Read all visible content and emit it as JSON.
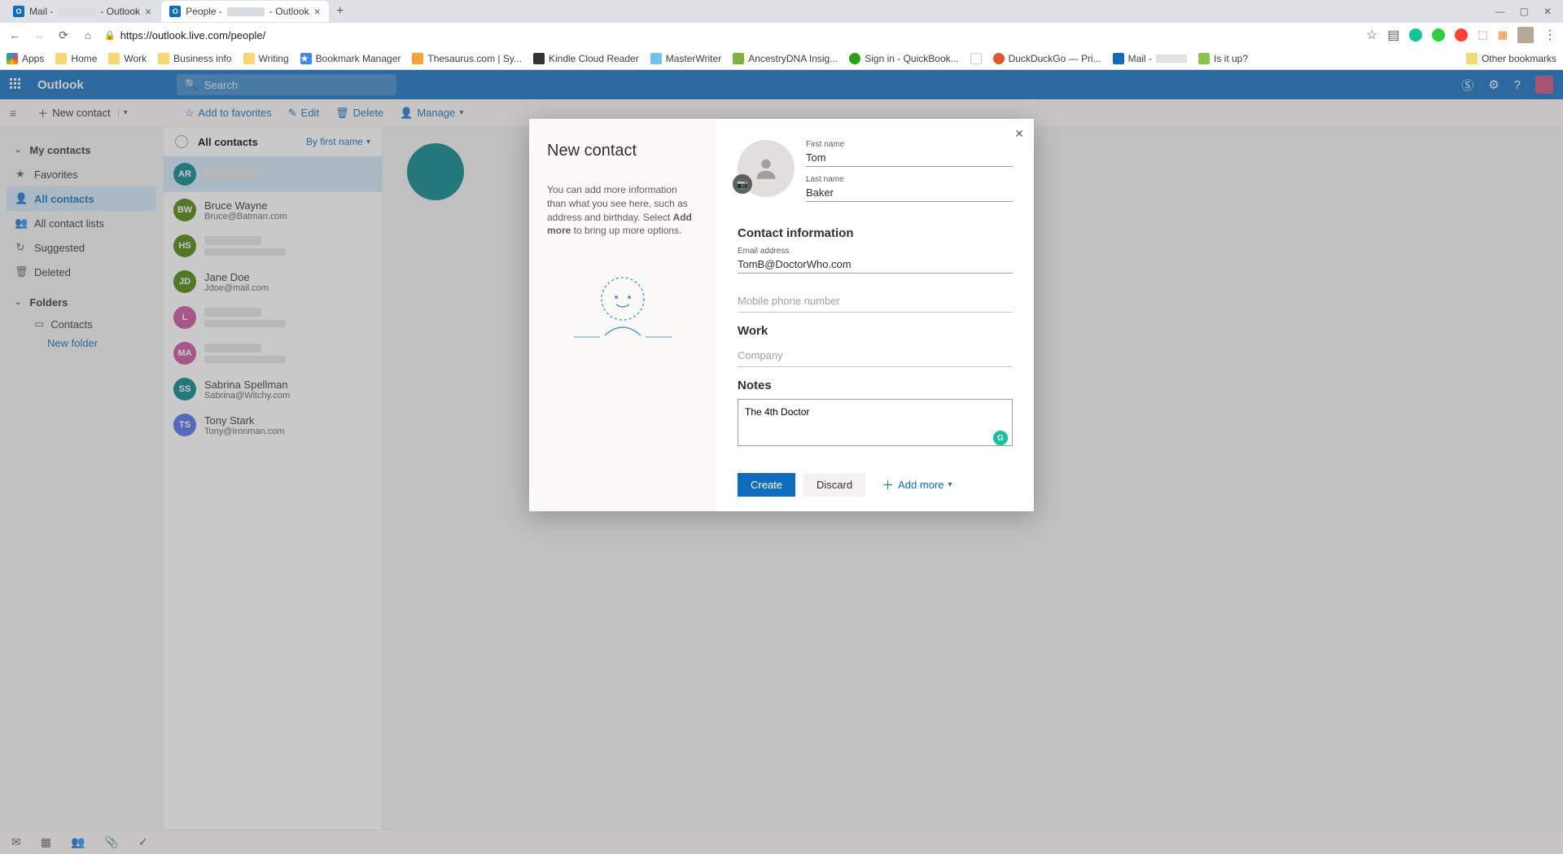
{
  "browser": {
    "tabs": [
      {
        "prefix": "Mail -",
        "suffix": "- Outlook"
      },
      {
        "prefix": "People -",
        "suffix": "- Outlook"
      }
    ],
    "url": "https://outlook.live.com/people/",
    "bookmarks": {
      "apps": "Apps",
      "items": [
        "Home",
        "Work",
        "Business info",
        "Writing",
        "Bookmark Manager",
        "Thesaurus.com | Sy...",
        "Kindle Cloud Reader",
        "MasterWriter",
        "AncestryDNA Insig...",
        "Sign in - QuickBook...",
        "DuckDuckGo — Pri...",
        "Mail -",
        "Is it up?"
      ],
      "other": "Other bookmarks"
    }
  },
  "header": {
    "brand": "Outlook",
    "search_placeholder": "Search"
  },
  "commands": {
    "new_contact": "New contact",
    "add_fav": "Add to favorites",
    "edit": "Edit",
    "delete": "Delete",
    "manage": "Manage"
  },
  "left_nav": {
    "my_contacts": "My contacts",
    "favorites": "Favorites",
    "all_contacts": "All contacts",
    "all_lists": "All contact lists",
    "suggested": "Suggested",
    "deleted": "Deleted",
    "folders": "Folders",
    "contacts_folder": "Contacts",
    "new_folder": "New folder"
  },
  "contact_list": {
    "title": "All contacts",
    "sort": "By first name",
    "items": [
      {
        "initials": "AR",
        "color": "#038387",
        "name": "",
        "email": "",
        "redacted": true,
        "selected": true
      },
      {
        "initials": "BW",
        "color": "#498205",
        "name": "Bruce Wayne",
        "email": "Bruce@Batman.com"
      },
      {
        "initials": "HS",
        "color": "#498205",
        "name": "",
        "email": "",
        "redacted": true
      },
      {
        "initials": "JD",
        "color": "#498205",
        "name": "Jane Doe",
        "email": "Jdoe@mail.com"
      },
      {
        "initials": "L",
        "color": "#c94f9c",
        "name": "",
        "email": "",
        "redacted": true
      },
      {
        "initials": "MA",
        "color": "#c94f9c",
        "name": "",
        "email": "",
        "redacted": true
      },
      {
        "initials": "SS",
        "color": "#038387",
        "name": "Sabrina Spellman",
        "email": "Sabrina@Witchy.com"
      },
      {
        "initials": "TS",
        "color": "#4f6bed",
        "name": "Tony Stark",
        "email": "Tony@Ironman.com"
      }
    ]
  },
  "modal": {
    "title": "New contact",
    "help_pre": "You can add more information than what you see here, such as address and birthday. Select ",
    "help_bold": "Add more",
    "help_post": " to bring up more options.",
    "first_name_label": "First name",
    "first_name_value": "Tom",
    "last_name_label": "Last name",
    "last_name_value": "Baker",
    "contact_info": "Contact information",
    "email_label": "Email address",
    "email_value": "TomB@DoctorWho.com",
    "mobile_placeholder": "Mobile phone number",
    "work": "Work",
    "company_placeholder": "Company",
    "notes": "Notes",
    "notes_value": "The 4th Doctor",
    "create": "Create",
    "discard": "Discard",
    "add_more": "Add more"
  }
}
